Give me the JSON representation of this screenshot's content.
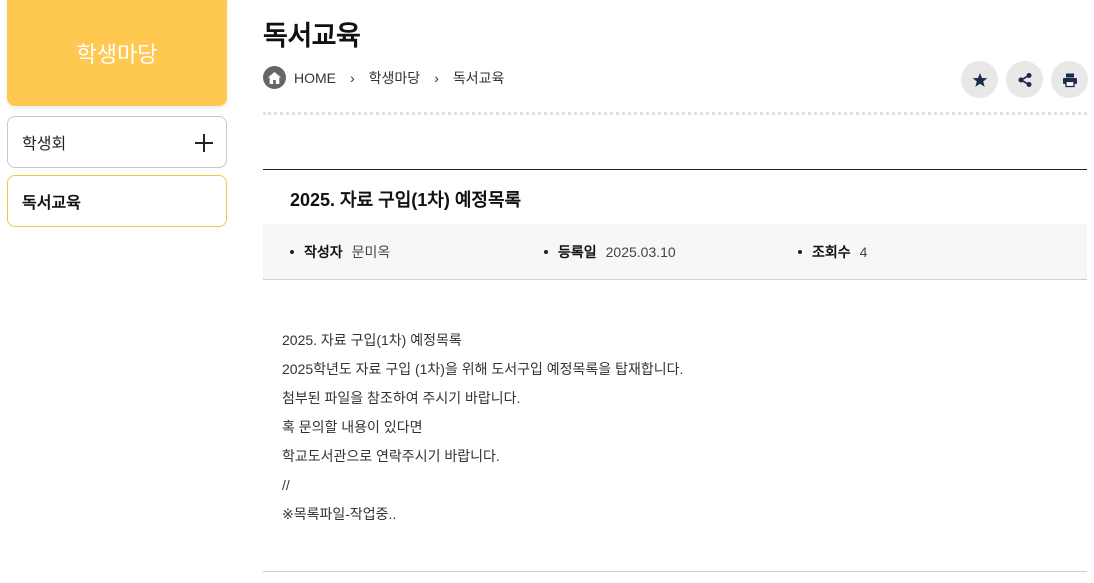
{
  "sidebar": {
    "title": "학생마당",
    "items": [
      {
        "label": "학생회"
      },
      {
        "label": "독서교육"
      }
    ]
  },
  "header": {
    "title": "독서교육",
    "breadcrumb": [
      "HOME",
      "학생마당",
      "독서교육"
    ],
    "tools": [
      "star-icon",
      "share-icon",
      "print-icon"
    ]
  },
  "post": {
    "title": "2025. 자료 구입(1차) 예정목록",
    "meta": {
      "author_label": "작성자",
      "author": "문미옥",
      "date_label": "등록일",
      "date": "2025.03.10",
      "views_label": "조회수",
      "views": "4"
    },
    "body": [
      "2025. 자료 구입(1차) 예정목록",
      "2025학년도 자료 구입 (1차)을 위해 도서구입 예정목록을 탑재합니다.",
      "첨부된 파일을 참조하여 주시기 바랍니다.",
      "혹 문의할 내용이 있다면",
      "학교도서관으로 연락주시기 바랍니다.",
      "//",
      "※목록파일-작업중.."
    ]
  },
  "colors": {
    "accent": "#ffc850",
    "active_border": "#f3c64b",
    "icon_dark": "#1d2a4d"
  }
}
